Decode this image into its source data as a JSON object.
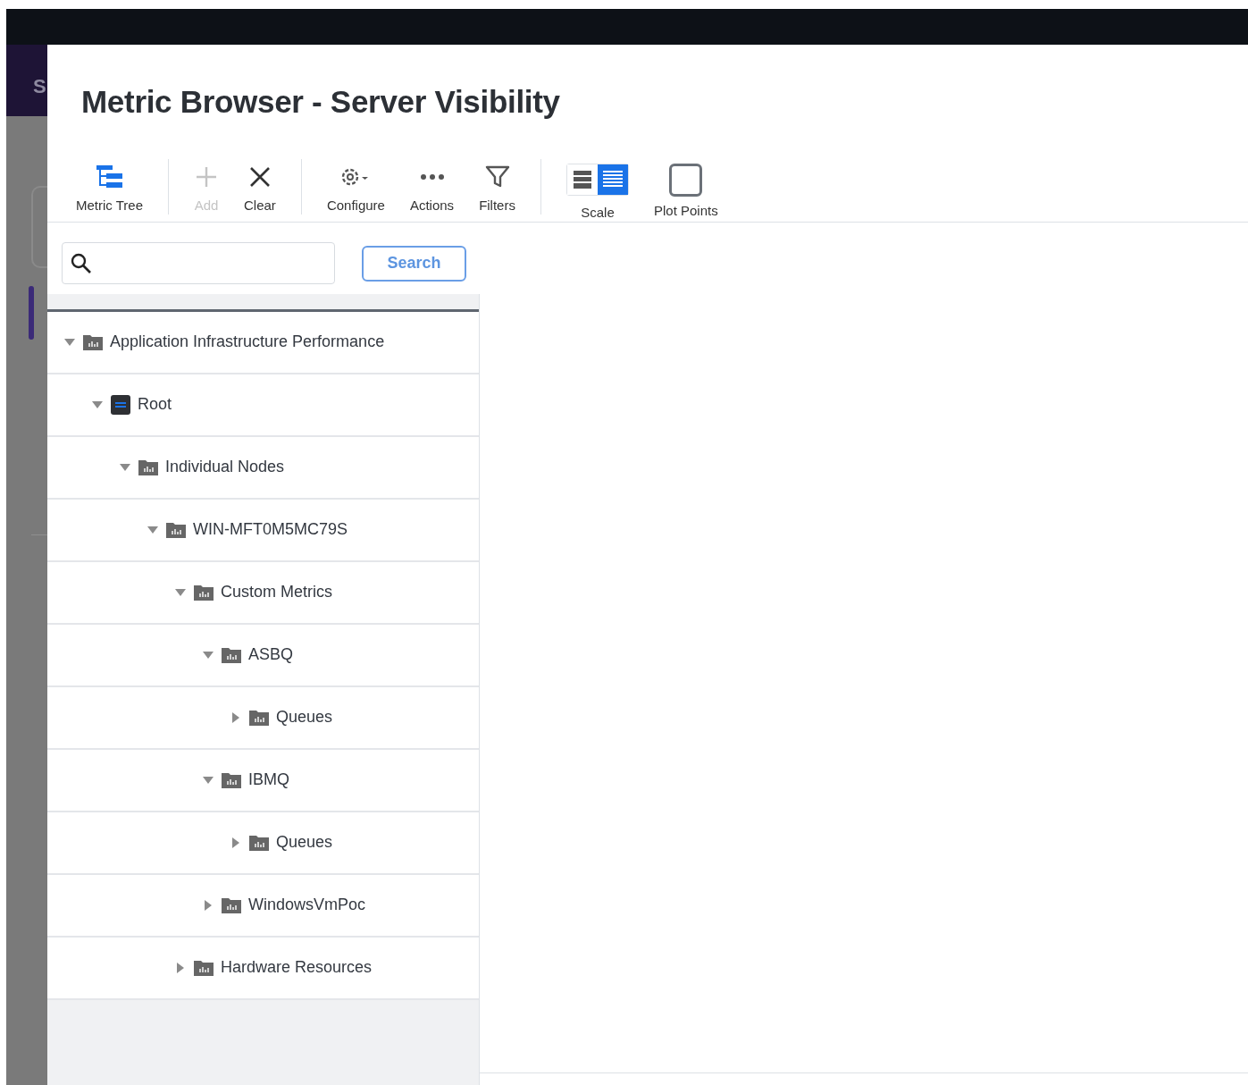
{
  "background": {
    "brand_text": "S"
  },
  "dialog": {
    "title": "Metric Browser - Server Visibility"
  },
  "toolbar": [
    {
      "kind": "tree",
      "label": "Metric Tree",
      "disabled": false
    },
    {
      "kind": "separator"
    },
    {
      "kind": "add",
      "label": "Add",
      "disabled": true
    },
    {
      "kind": "clear",
      "label": "Clear",
      "disabled": false
    },
    {
      "kind": "separator"
    },
    {
      "kind": "configure",
      "label": "Configure",
      "disabled": false
    },
    {
      "kind": "actions",
      "label": "Actions",
      "disabled": false
    },
    {
      "kind": "filters",
      "label": "Filters",
      "disabled": false
    },
    {
      "kind": "separator"
    },
    {
      "kind": "scale",
      "label": "Scale",
      "options": [
        {
          "selected": false
        },
        {
          "selected": true
        }
      ]
    },
    {
      "kind": "plot",
      "label": "Plot Points",
      "checked": false
    }
  ],
  "search": {
    "button": "Search"
  },
  "tree": [
    {
      "label": "Application Infrastructure Performance",
      "kind": "folder",
      "expanded": true,
      "children": [
        {
          "label": "Root",
          "kind": "root",
          "expanded": true,
          "children": [
            {
              "label": "Individual Nodes",
              "kind": "folder",
              "expanded": true,
              "children": [
                {
                  "label": "WIN-MFT0M5MC79S",
                  "kind": "folder",
                  "expanded": true,
                  "children": [
                    {
                      "label": "Custom Metrics",
                      "kind": "folder",
                      "expanded": true,
                      "children": [
                        {
                          "label": "ASBQ",
                          "kind": "folder",
                          "expanded": true,
                          "children": [
                            {
                              "label": "Queues",
                              "kind": "folder",
                              "expanded": false
                            }
                          ]
                        },
                        {
                          "label": "IBMQ",
                          "kind": "folder",
                          "expanded": true,
                          "children": [
                            {
                              "label": "Queues",
                              "kind": "folder",
                              "expanded": false
                            }
                          ]
                        },
                        {
                          "label": "WindowsVmPoc",
                          "kind": "folder",
                          "expanded": false
                        }
                      ]
                    },
                    {
                      "label": "Hardware Resources",
                      "kind": "folder",
                      "expanded": false
                    }
                  ]
                }
              ]
            }
          ]
        }
      ]
    }
  ]
}
